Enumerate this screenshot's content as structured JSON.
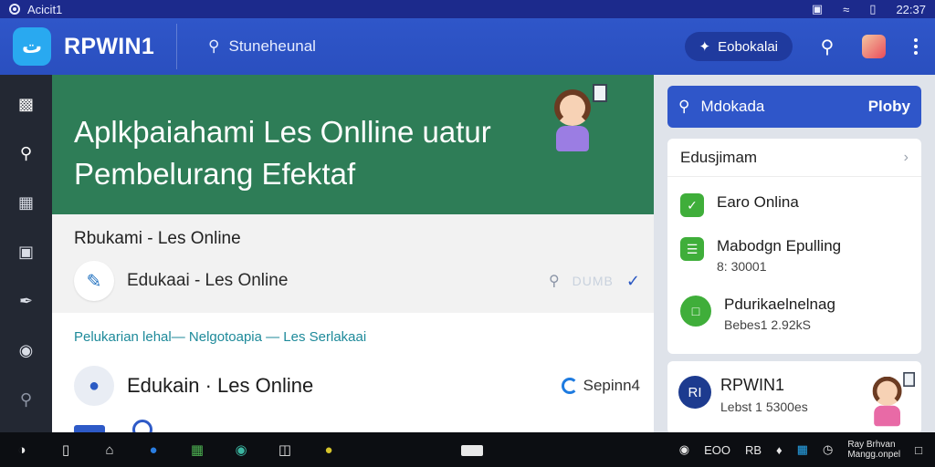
{
  "statusbar": {
    "left_text": "Acicit1",
    "time": "22:37"
  },
  "colors": {
    "header_blue": "#2f56c9",
    "hero_green": "#2e7d57",
    "logo_blue": "#29a9f0",
    "success_green": "#3fae3a"
  },
  "header": {
    "title": "RPWIN1",
    "search_placeholder": "Stuneheunal",
    "pill_label": "Eobokalai"
  },
  "rail": {
    "items": [
      "dashboard-icon",
      "search-icon",
      "chart-icon",
      "file-icon",
      "pill-icon",
      "eye-icon",
      "zoom-icon"
    ]
  },
  "hero": {
    "title": "Aplkþaiahami Les Onlline uatur Pembelurang Efektaf"
  },
  "section1": {
    "title": "Rbukami - Les Online",
    "row_label": "Edukaai - Les Online",
    "tool_text": "DUMB"
  },
  "section2": {
    "breadcrumb": "Pelukarian lehal— Nelgotoapia — Les Serlakaai",
    "row_label": "Edukain · Les Online",
    "status_text": "Sepinn4"
  },
  "rightpanel": {
    "search_label": "Mdokada",
    "search_button": "Ploby",
    "card_title": "Edusjimam",
    "items": [
      {
        "title": "Earo Onlina",
        "sub": ""
      },
      {
        "title": "Mabodgn Epulling",
        "sub": "8: 30001"
      },
      {
        "title": "Pdurikaelnelnag",
        "sub": "Bebes1 2.92kS"
      }
    ],
    "card2": {
      "title": "RPWIN1",
      "sub": "Lebst 1 5300es",
      "avatar_text": "RI"
    }
  },
  "taskbar": {
    "tray_text_1": "EOO",
    "tray_text_2": "RB",
    "clock_line1": "Ray Brhvan",
    "clock_line2": "Mangg.onpel"
  }
}
